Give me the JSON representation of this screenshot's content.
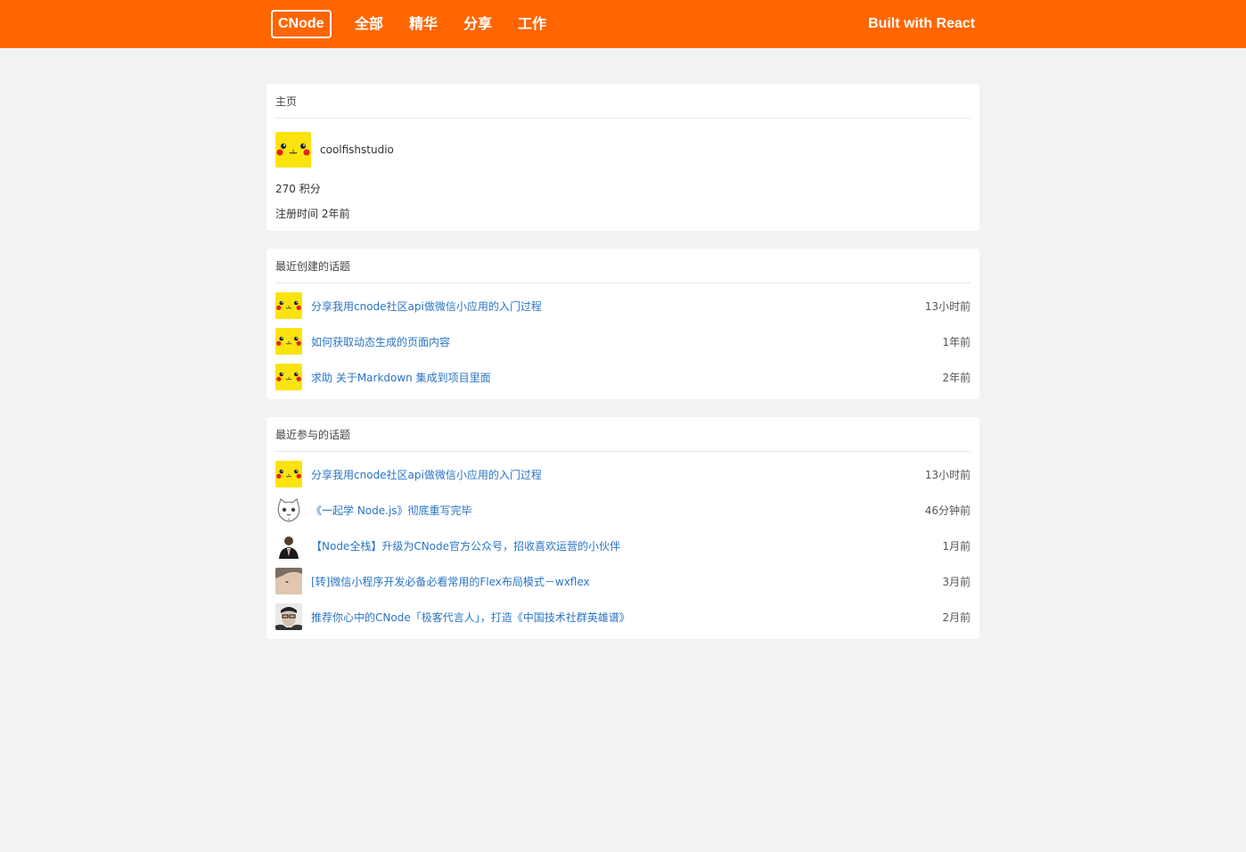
{
  "header": {
    "logo": "CNode",
    "nav": [
      "全部",
      "精华",
      "分享",
      "工作"
    ],
    "built_with": "Built with React",
    "bg_color": "#ff6600"
  },
  "profile": {
    "heading": "主页",
    "username": "coolfishstudio",
    "avatar": "pikachu-avatar",
    "score": "270 积分",
    "registered": "注册时间 2年前"
  },
  "created": {
    "heading": "最近创建的话题",
    "topics": [
      {
        "title": "分享我用cnode社区api做微信小应用的入门过程",
        "time": "13小时前",
        "avatar": "pikachu-avatar"
      },
      {
        "title": "如何获取动态生成的页面内容",
        "time": "1年前",
        "avatar": "pikachu-avatar"
      },
      {
        "title": "求助 关于Markdown 集成到项目里面",
        "time": "2年前",
        "avatar": "pikachu-avatar"
      }
    ]
  },
  "joined": {
    "heading": "最近参与的话题",
    "topics": [
      {
        "title": "分享我用cnode社区api做微信小应用的入门过程",
        "time": "13小时前",
        "avatar": "pikachu-avatar"
      },
      {
        "title": "《一起学 Node.js》彻底重写完毕",
        "time": "46分钟前",
        "avatar": "cat-avatar"
      },
      {
        "title": "【Node全栈】升级为CNode官方公众号，招收喜欢运营的小伙伴",
        "time": "1月前",
        "avatar": "person-suit-avatar"
      },
      {
        "title": "[转]微信小程序开发必备必看常用的Flex布局模式－wxflex",
        "time": "3月前",
        "avatar": "person-photo-avatar"
      },
      {
        "title": "推荐你心中的CNode「极客代言人」，打造《中国技术社群英雄谱》",
        "time": "2月前",
        "avatar": "person-glasses-avatar"
      }
    ]
  }
}
